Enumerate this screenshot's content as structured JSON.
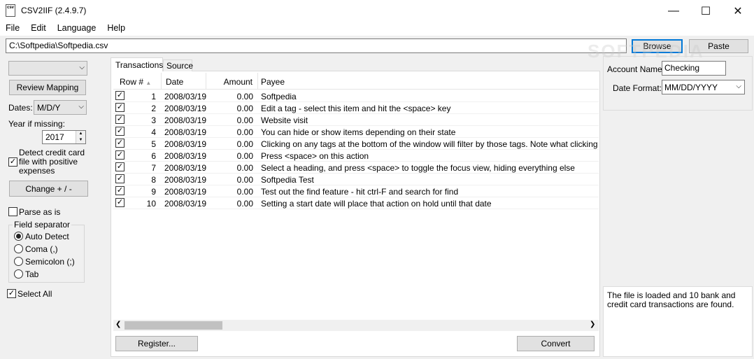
{
  "window": {
    "title": "CSV2IIF (2.4.9.7)",
    "icon_text": "csv",
    "minimize": "—",
    "maximize": "☐",
    "close": "✕"
  },
  "menu": [
    "File",
    "Edit",
    "Language",
    "Help"
  ],
  "path": {
    "value": "C:\\Softpedia\\Softpedia.csv",
    "browse": "Browse",
    "paste": "Paste"
  },
  "watermark": "SOFTPEDIA",
  "left": {
    "top_combo": "",
    "review_mapping": "Review Mapping",
    "dates_label": "Dates:",
    "dates_value": "M/D/Y",
    "year_label": "Year if missing:",
    "year_value": "2017",
    "detect_label": "Detect credit card file with positive expenses",
    "change_label": "Change + / -",
    "parse_label": "Parse as is",
    "field_separator": "Field separator",
    "separators": [
      "Auto Detect",
      "Coma (,)",
      "Semicolon (;)",
      "Tab"
    ],
    "selected_separator": 0,
    "select_all": "Select All"
  },
  "tabs": [
    "Transactions",
    "Source"
  ],
  "grid": {
    "columns": [
      "Row #",
      "Date",
      "Amount",
      "Payee"
    ],
    "rows": [
      {
        "n": "1",
        "date": "2008/03/19",
        "amount": "0.00",
        "payee": "Softpedia"
      },
      {
        "n": "2",
        "date": "2008/03/19",
        "amount": "0.00",
        "payee": "Edit a tag - select this item and hit the <space> key"
      },
      {
        "n": "3",
        "date": "2008/03/19",
        "amount": "0.00",
        "payee": "Website visit"
      },
      {
        "n": "4",
        "date": "2008/03/19",
        "amount": "0.00",
        "payee": "You can hide or show items depending on their state"
      },
      {
        "n": "5",
        "date": "2008/03/19",
        "amount": "0.00",
        "payee": "Clicking on any tags at the bottom of the window will filter by those tags.  Note what clicking on the '"
      },
      {
        "n": "6",
        "date": "2008/03/19",
        "amount": "0.00",
        "payee": "Press <space> on this action"
      },
      {
        "n": "7",
        "date": "2008/03/19",
        "amount": "0.00",
        "payee": "Select a heading, and press <space> to toggle the focus view, hiding everything else"
      },
      {
        "n": "8",
        "date": "2008/03/19",
        "amount": "0.00",
        "payee": "Softpedia Test"
      },
      {
        "n": "9",
        "date": "2008/03/19",
        "amount": "0.00",
        "payee": "Test out the find feature - hit ctrl-F and search for find"
      },
      {
        "n": "10",
        "date": "2008/03/19",
        "amount": "0.00",
        "payee": "Setting a start date will place that action on hold until that date"
      }
    ]
  },
  "bottom": {
    "register": "Register...",
    "convert": "Convert"
  },
  "right": {
    "account_label": "Account Name:",
    "account_value": "Checking",
    "date_format_label": "Date Format:",
    "date_format_value": "MM/DD/YYYY",
    "status": "The file is loaded and 10 bank and credit card transactions are found."
  }
}
